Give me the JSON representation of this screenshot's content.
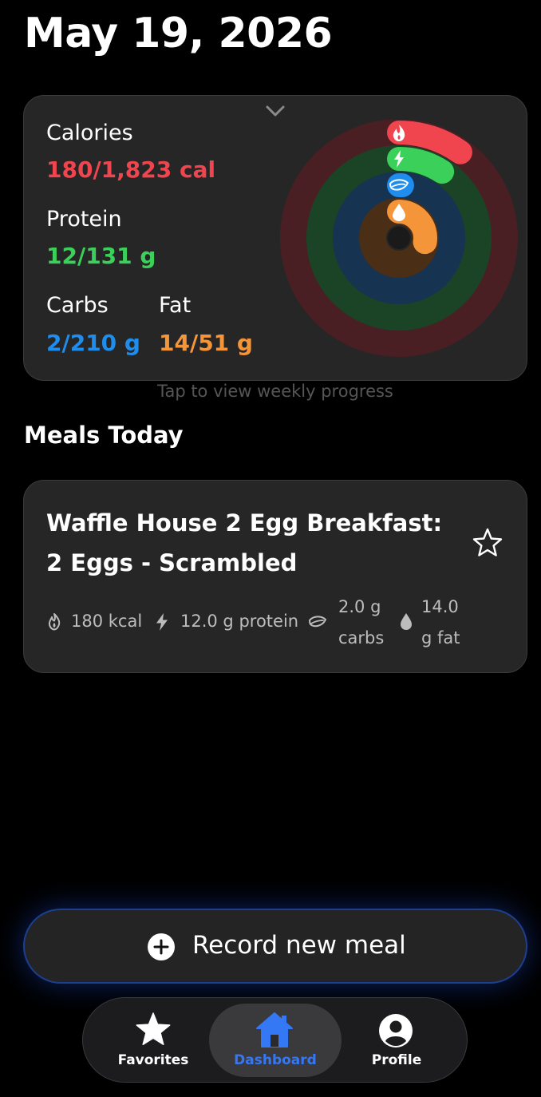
{
  "header": {
    "date": "May 19, 2026"
  },
  "summary": {
    "calories": {
      "label": "Calories",
      "value": "180/1,823 cal",
      "color": "#f0454f",
      "progress": 0.099
    },
    "protein": {
      "label": "Protein",
      "value": "12/131 g",
      "color": "#3ad05a",
      "progress": 0.092
    },
    "carbs": {
      "label": "Carbs",
      "value": "2/210 g",
      "color": "#1f8dee",
      "progress": 0.0095
    },
    "fat": {
      "label": "Fat",
      "value": "14/51 g",
      "color": "#f5953a",
      "progress": 0.275
    },
    "hint": "Tap to view weekly progress",
    "icons": [
      "chevron-down-icon",
      "flame-icon",
      "bolt-icon",
      "leaf-icon",
      "drop-icon"
    ]
  },
  "meals": {
    "title": "Meals Today",
    "items": [
      {
        "name": "Waffle House 2 Egg Breakfast: 2 Eggs - Scrambled",
        "kcal": "180 kcal",
        "protein": "12.0 g protein",
        "carbs_line1": "2.0 g",
        "carbs_line2": "carbs",
        "fat_line1": "14.0",
        "fat_line2": "g fat",
        "favorite": false
      }
    ]
  },
  "actions": {
    "record_label": "Record new meal"
  },
  "tabs": [
    {
      "label": "Favorites",
      "icon": "star-icon",
      "active": false
    },
    {
      "label": "Dashboard",
      "icon": "home-icon",
      "active": true
    },
    {
      "label": "Profile",
      "icon": "person-icon",
      "active": false
    }
  ],
  "colors": {
    "accent": "#3478f6",
    "background": "#000000",
    "card": "#262626"
  }
}
